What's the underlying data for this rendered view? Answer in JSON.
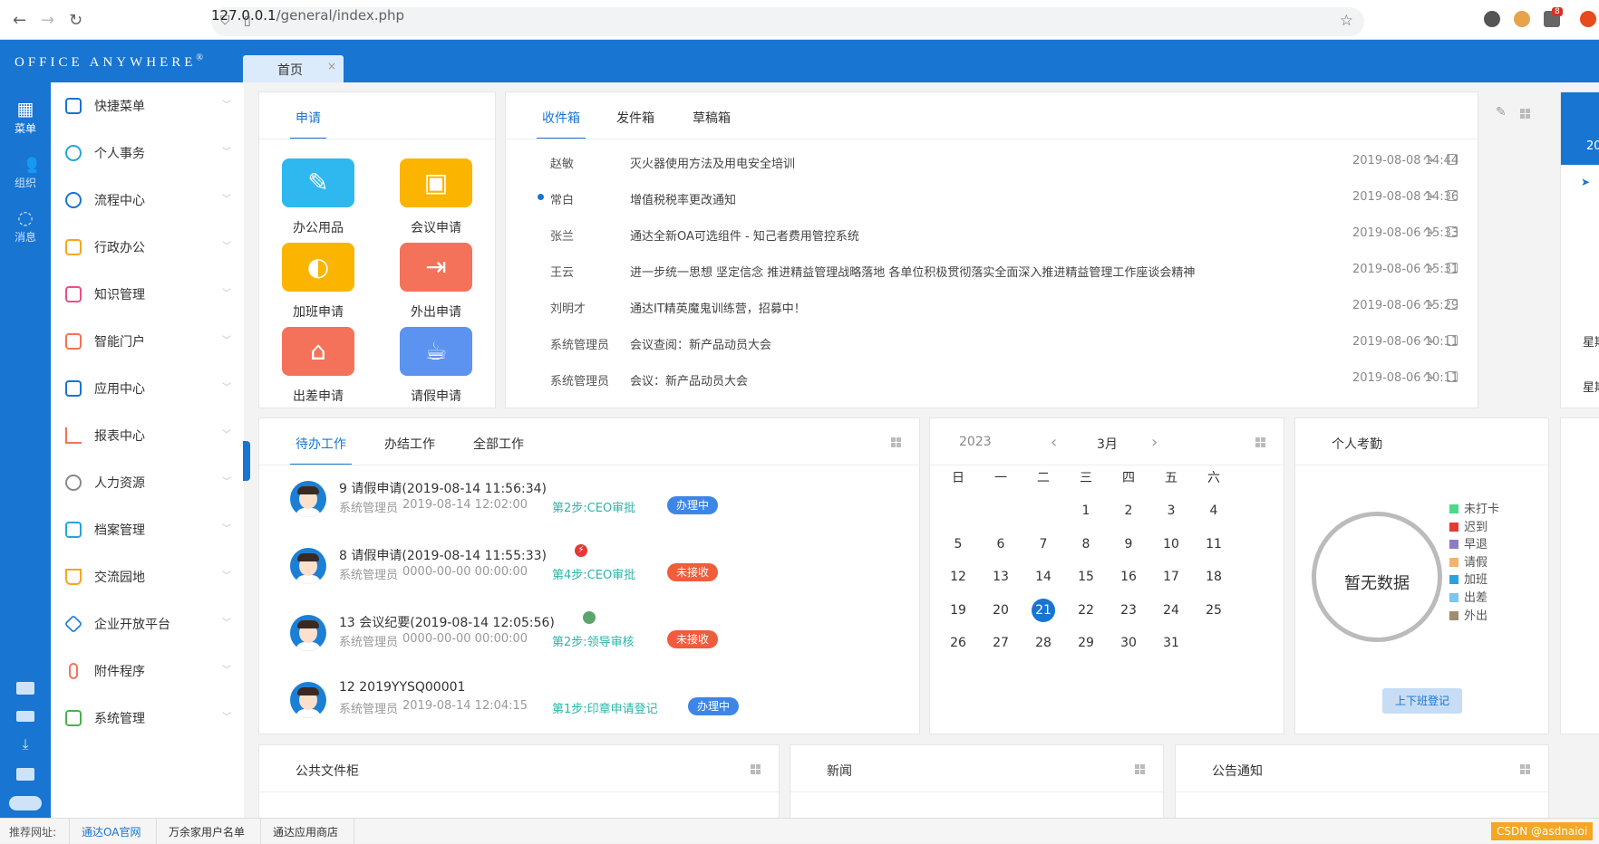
{
  "browser": {
    "url_host": "127.0.0.1",
    "url_path": "/general/index.php",
    "ext_badge": "8"
  },
  "app": {
    "logo": "Office Anywhere",
    "logo_mark": "®",
    "home_tab": "首页",
    "close_glyph": "×",
    "accent": "#1875d1"
  },
  "rail": {
    "items": [
      {
        "label": "菜单",
        "icon": "grid-icon"
      },
      {
        "label": "组织",
        "icon": "people-icon"
      },
      {
        "label": "消息",
        "icon": "chat-icon"
      }
    ]
  },
  "menu": {
    "items": [
      {
        "label": "快捷菜单",
        "icon": "quick-menu-icon"
      },
      {
        "label": "个人事务",
        "icon": "user-icon"
      },
      {
        "label": "流程中心",
        "icon": "flow-icon"
      },
      {
        "label": "行政办公",
        "icon": "briefcase-icon"
      },
      {
        "label": "知识管理",
        "icon": "book-icon"
      },
      {
        "label": "智能门户",
        "icon": "portal-icon"
      },
      {
        "label": "应用中心",
        "icon": "app-icon"
      },
      {
        "label": "报表中心",
        "icon": "bar-chart-icon"
      },
      {
        "label": "人力资源",
        "icon": "hr-icon"
      },
      {
        "label": "档案管理",
        "icon": "archive-icon"
      },
      {
        "label": "交流园地",
        "icon": "cup-icon"
      },
      {
        "label": "企业开放平台",
        "icon": "cube-icon"
      },
      {
        "label": "附件程序",
        "icon": "paperclip-icon"
      },
      {
        "label": "系统管理",
        "icon": "settings-icon"
      }
    ]
  },
  "apply": {
    "tab": "申请",
    "items": [
      {
        "label": "办公用品",
        "color": "#2fb8f0"
      },
      {
        "label": "会议申请",
        "color": "#fbb400"
      },
      {
        "label": "加班申请",
        "color": "#fbb400"
      },
      {
        "label": "外出申请",
        "color": "#f5725a"
      },
      {
        "label": "出差申请",
        "color": "#f5725a"
      },
      {
        "label": "请假申请",
        "color": "#5c93f0"
      }
    ]
  },
  "mail": {
    "tabs": [
      "收件箱",
      "发件箱",
      "草稿箱"
    ],
    "rows": [
      {
        "from": "赵敏",
        "subject": "灭火器使用方法及用电安全培训",
        "time": "2019-08-08 14:44",
        "unread": false
      },
      {
        "from": "常白",
        "subject": "增值税税率更改通知",
        "time": "2019-08-08 14:36",
        "unread": true
      },
      {
        "from": "张兰",
        "subject": "通达全新OA可选组件 - 知己者费用管控系统",
        "time": "2019-08-06 15:33",
        "unread": false
      },
      {
        "from": "王云",
        "subject": "进一步统一思想 坚定信念 推进精益管理战略落地 各单位积极贯彻落实全面深入推进精益管理工作座谈会精神",
        "time": "2019-08-06 15:31",
        "unread": false
      },
      {
        "from": "刘明才",
        "subject": "通达IT精英魔鬼训练营，招募中！",
        "time": "2019-08-06 15:29",
        "unread": false
      },
      {
        "from": "系统管理员",
        "subject": "会议查阅：新产品动员大会",
        "time": "2019-08-06 10:11",
        "unread": false
      },
      {
        "from": "系统管理员",
        "subject": "会议：新产品动员大会",
        "time": "2019-08-06 10:11",
        "unread": false
      }
    ]
  },
  "work": {
    "tabs": [
      "待办工作",
      "办结工作",
      "全部工作"
    ],
    "rows": [
      {
        "title": "9   请假申请(2019-08-14 11:56:34)",
        "user": "系统管理员",
        "time": "2019-08-14 12:02:00",
        "step": "第2步:CEO审批",
        "status": "办理中",
        "status_type": "blue",
        "flag": ""
      },
      {
        "title": "8   请假申请(2019-08-14 11:55:33)",
        "user": "系统管理员",
        "time": "0000-00-00 00:00:00",
        "step": "第4步:CEO审批",
        "status": "未接收",
        "status_type": "red",
        "flag": "urgent-icon"
      },
      {
        "title": "13   会议纪要(2019-08-14 12:05:56)",
        "user": "系统管理员",
        "time": "0000-00-00 00:00:00",
        "step": "第2步:领导审核",
        "status": "未接收",
        "status_type": "red",
        "flag": "globe-icon"
      },
      {
        "title": "12   2019YYSQ00001",
        "user": "系统管理员",
        "time": "2019-08-14 12:04:15",
        "step": "第1步:印章申请登记",
        "status": "办理中",
        "status_type": "blue",
        "flag": ""
      }
    ]
  },
  "calendar": {
    "year": "2023",
    "month": "3月",
    "weekdays": [
      "日",
      "一",
      "二",
      "三",
      "四",
      "五",
      "六"
    ],
    "first_weekday": 3,
    "days": 31,
    "today": 21
  },
  "attendance": {
    "title": "个人考勤",
    "empty": "暂无数据",
    "button": "上下班登记",
    "legend": [
      {
        "label": "未打卡",
        "color": "#4cd98a"
      },
      {
        "label": "迟到",
        "color": "#e53935"
      },
      {
        "label": "早退",
        "color": "#8e7cc3"
      },
      {
        "label": "请假",
        "color": "#f6b26b"
      },
      {
        "label": "加班",
        "color": "#29a3dc"
      },
      {
        "label": "出差",
        "color": "#7cc6f0"
      },
      {
        "label": "外出",
        "color": "#a08c6e"
      }
    ]
  },
  "bottom_panels": [
    "公共文件柜",
    "新闻",
    "公告通知"
  ],
  "right_strip": {
    "text1": "20",
    "text2": "星期",
    "text3": "星期"
  },
  "footer": {
    "label": "推荐网址:",
    "links": [
      "通达OA官网",
      "万余家用户名单",
      "通达应用商店"
    ],
    "watermark": "CSDN @asdnaioi"
  }
}
